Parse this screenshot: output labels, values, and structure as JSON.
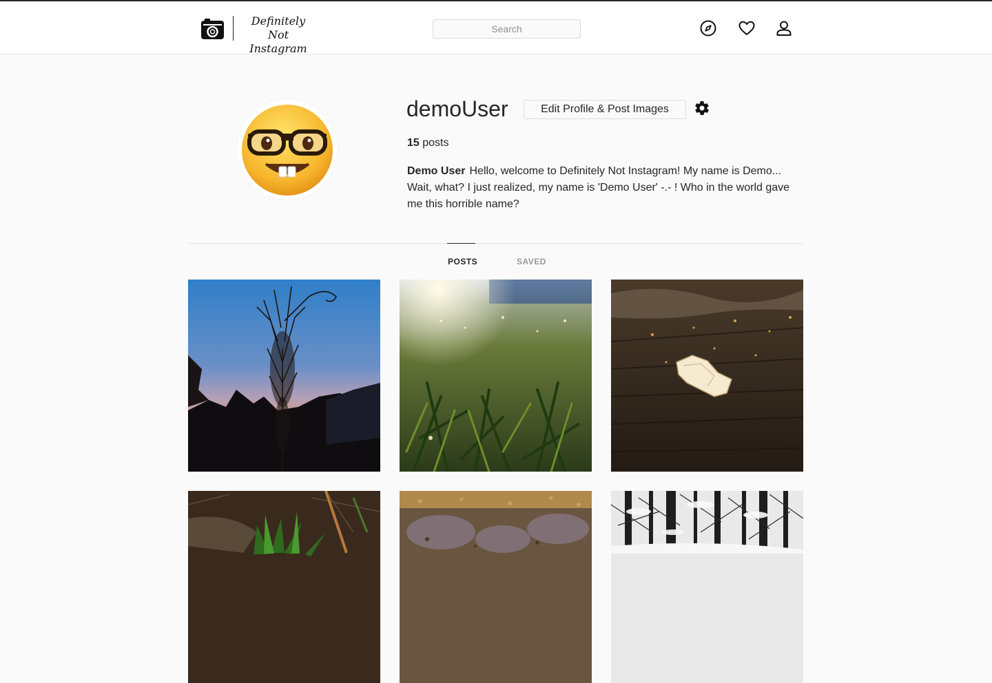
{
  "header": {
    "brand_line1": "Definitely Not",
    "brand_line2": "Instagram",
    "search_placeholder": "Search",
    "icons": [
      "camera-logo-icon",
      "compass-icon",
      "heart-icon",
      "user-icon"
    ]
  },
  "profile": {
    "username": "demoUser",
    "edit_button_label": "Edit Profile & Post Images",
    "settings_icon": "gear-icon",
    "post_count": "15",
    "post_count_label": "posts",
    "full_name": "Demo User",
    "bio": "Hello, welcome to Definitely Not Instagram! My name is Demo... Wait, what? I just realized, my name is 'Demo User' -.- ! Who in the world gave me this horrible name?",
    "avatar": "nerd-face-emoji"
  },
  "tabs": [
    {
      "label": "POSTS",
      "active": true
    },
    {
      "label": "SAVED",
      "active": false
    }
  ],
  "posts": [
    {
      "subject": "plant silhouette at sunset"
    },
    {
      "subject": "grass close-up in sunlight"
    },
    {
      "subject": "ice crystal on pavement"
    },
    {
      "subject": "green shoots in soil"
    },
    {
      "subject": "ground with leaves"
    },
    {
      "subject": "snowy forest"
    }
  ],
  "colors": {
    "background": "#fafafa",
    "text": "#262626",
    "muted": "#999999",
    "border": "#dbdbdb"
  }
}
